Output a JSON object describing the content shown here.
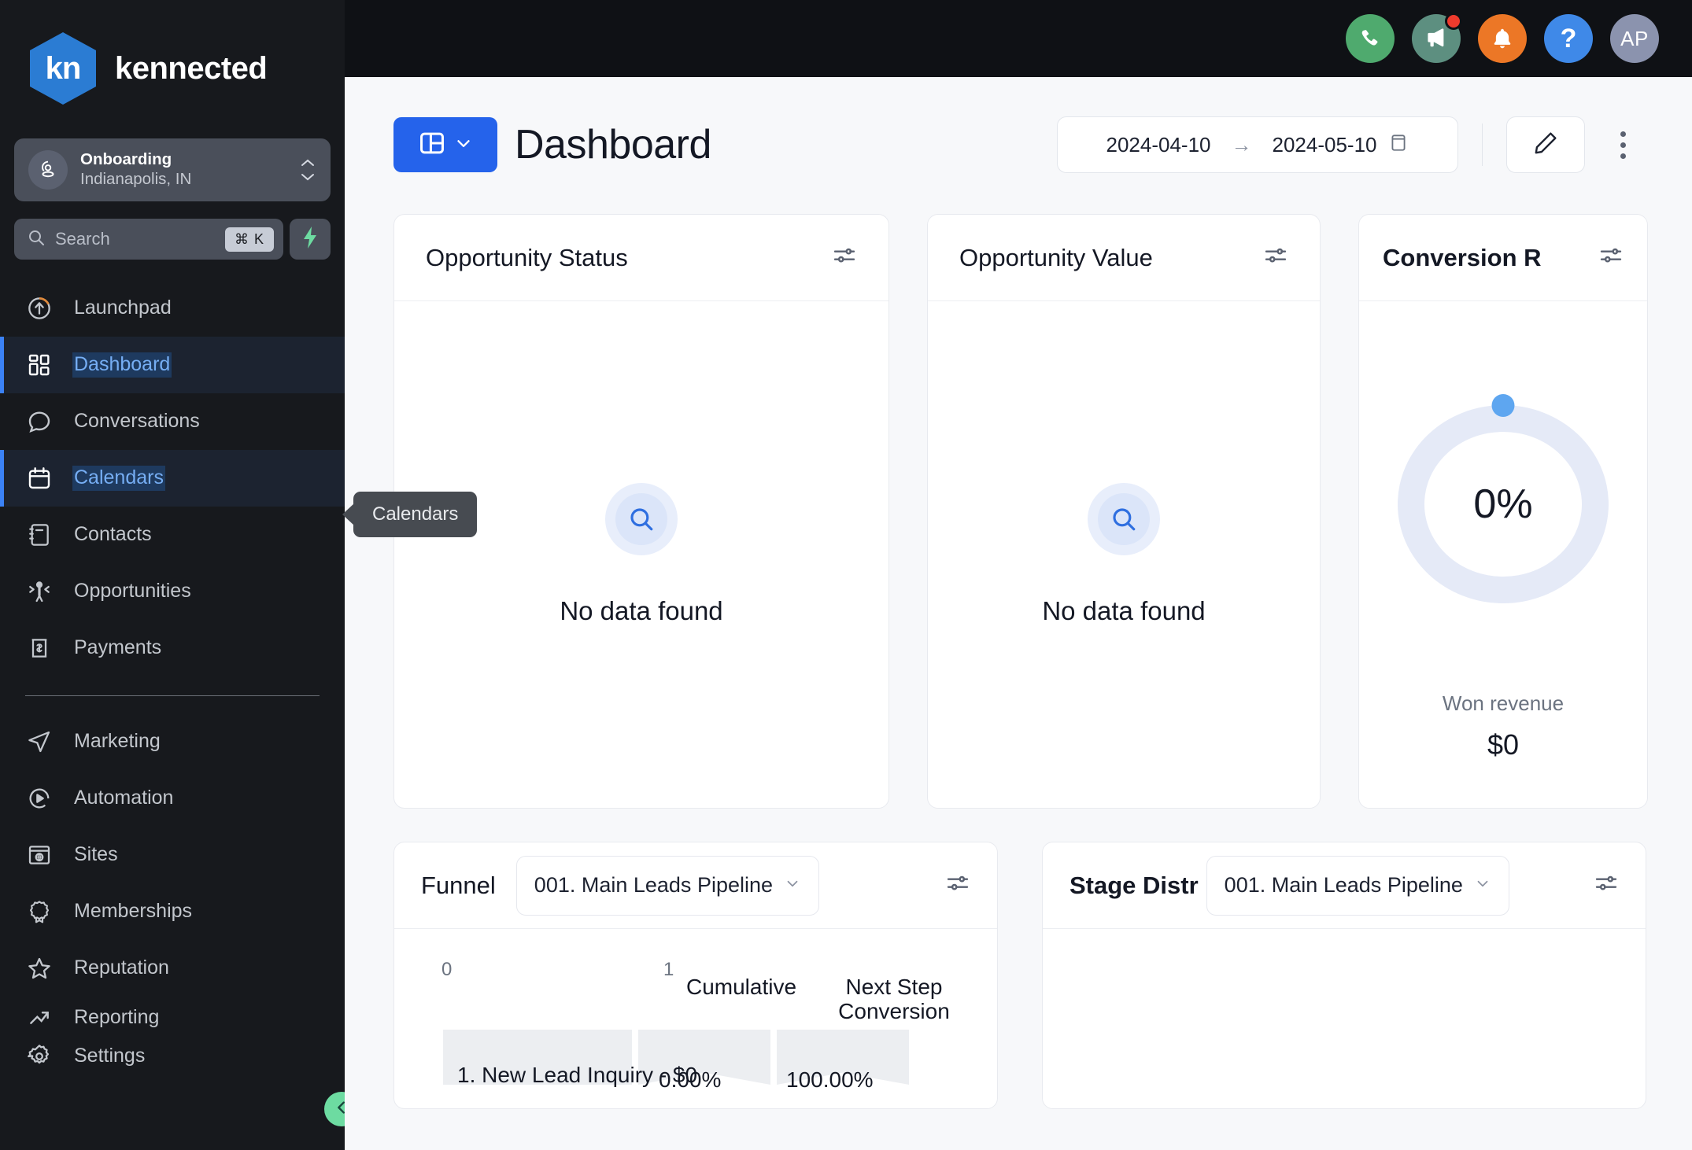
{
  "brand": {
    "logo_text": "kn",
    "name": "kennected"
  },
  "location": {
    "name": "Onboarding",
    "sub": "Indianapolis, IN"
  },
  "search": {
    "placeholder": "Search",
    "shortcut": "⌘ K"
  },
  "sidebar": {
    "items": [
      {
        "label": "Launchpad",
        "icon": "launchpad-icon",
        "active": false
      },
      {
        "label": "Dashboard",
        "icon": "dashboard-icon",
        "active": true
      },
      {
        "label": "Conversations",
        "icon": "conversations-icon",
        "active": false
      },
      {
        "label": "Calendars",
        "icon": "calendar-icon",
        "active": true
      },
      {
        "label": "Contacts",
        "icon": "contacts-icon",
        "active": false
      },
      {
        "label": "Opportunities",
        "icon": "opportunities-icon",
        "active": false
      },
      {
        "label": "Payments",
        "icon": "payments-icon",
        "active": false
      }
    ],
    "items2": [
      {
        "label": "Marketing",
        "icon": "send-icon"
      },
      {
        "label": "Automation",
        "icon": "play-circle-icon"
      },
      {
        "label": "Sites",
        "icon": "sites-icon"
      },
      {
        "label": "Memberships",
        "icon": "badge-icon"
      },
      {
        "label": "Reputation",
        "icon": "star-icon"
      },
      {
        "label": "Reporting",
        "icon": "reporting-icon"
      },
      {
        "label": "Settings",
        "icon": "gear-icon"
      }
    ]
  },
  "tooltip": {
    "text": "Calendars"
  },
  "topbar": {
    "icons": [
      {
        "name": "phone-icon",
        "color": "#4faa6e",
        "badge": false
      },
      {
        "name": "megaphone-icon",
        "color": "#5d8f80",
        "badge": true
      },
      {
        "name": "bell-icon",
        "color": "#ec7726",
        "badge": false
      },
      {
        "name": "help-icon",
        "color": "#3f89e8",
        "badge": false
      }
    ],
    "avatar": "AP"
  },
  "header": {
    "title": "Dashboard",
    "date_start": "2024-04-10",
    "date_end": "2024-05-10",
    "arrow": "→"
  },
  "cards": {
    "opportunity_status": {
      "title": "Opportunity Status",
      "empty_text": "No data found"
    },
    "opportunity_value": {
      "title": "Opportunity Value",
      "empty_text": "No data found"
    },
    "conversion_rate": {
      "title": "Conversion R",
      "percent": "0%",
      "won_label": "Won revenue",
      "won_value": "$0"
    }
  },
  "funnel": {
    "title": "Funnel",
    "pipeline": "001. Main Leads Pipeline"
  },
  "stage_distribution": {
    "title": "Stage Distr",
    "pipeline": "001. Main Leads Pipeline"
  },
  "chart_data": {
    "type": "bar",
    "title": "Funnel",
    "xlabel": "",
    "ylabel": "",
    "x_ticks": [
      "0",
      "1"
    ],
    "xlim": [
      0,
      1
    ],
    "grid": false,
    "legend": "none",
    "column_headers": [
      "Cumulative",
      "Next Step Conversion"
    ],
    "categories": [
      "1. New Lead Inquiry - $0"
    ],
    "values": [
      1
    ],
    "rows": [
      {
        "stage": "1. New Lead Inquiry - $0",
        "cumulative": "0.00%",
        "next_step_conversion": "100.00%"
      }
    ]
  },
  "colors": {
    "brand_blue": "#2b7cd3",
    "accent_blue": "#2563eb",
    "active_text": "#76aef4",
    "sidebar_bg": "#17191d",
    "canvas_bg": "#f7f8fa",
    "donut_track": "#e5eaf7",
    "donut_dot": "#5ea6f0",
    "green_toggle": "#6ddba1"
  }
}
